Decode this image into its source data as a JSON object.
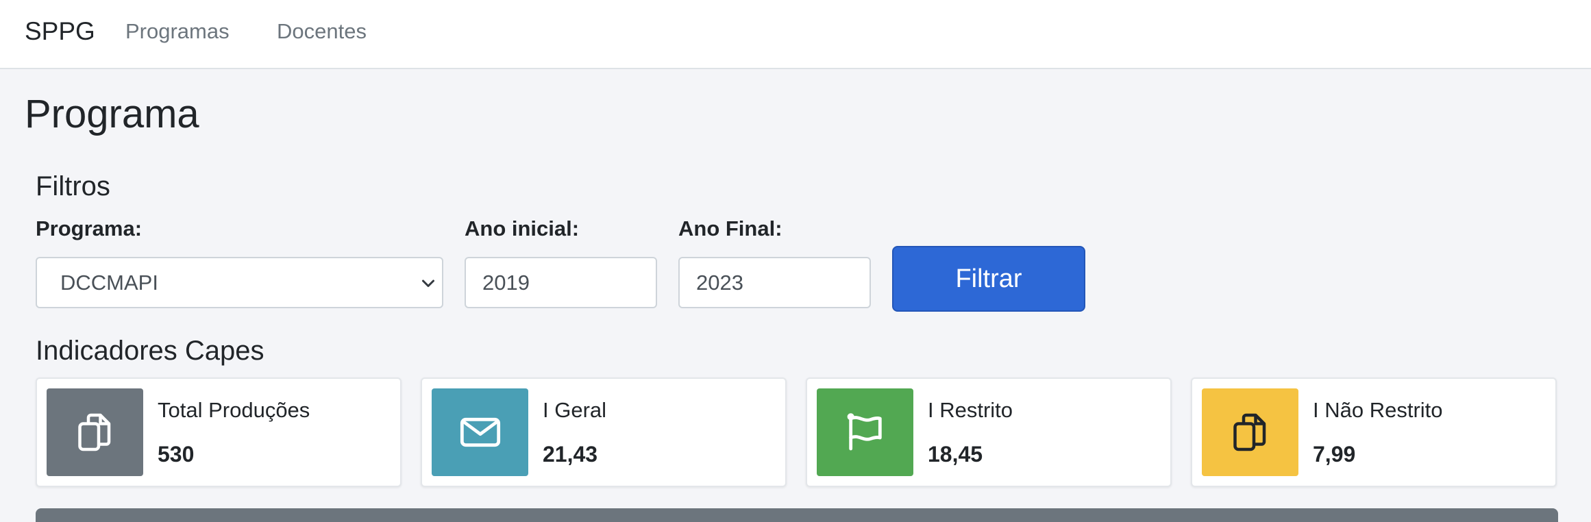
{
  "nav": {
    "brand": "SPPG",
    "links": [
      "Programas",
      "Docentes"
    ]
  },
  "page": {
    "title": "Programa"
  },
  "filters": {
    "title": "Filtros",
    "programa": {
      "label": "Programa:",
      "value": "DCCMAPI"
    },
    "ano_inicial": {
      "label": "Ano inicial:",
      "value": "2019"
    },
    "ano_final": {
      "label": "Ano Final:",
      "value": "2023"
    },
    "submit_label": "Filtrar"
  },
  "indicators": {
    "title": "Indicadores Capes",
    "cards": [
      {
        "label": "Total Produções",
        "value": "530",
        "icon": "copy-icon",
        "color": "#6c757d"
      },
      {
        "label": "I Geral",
        "value": "21,43",
        "icon": "envelope-icon",
        "color": "#4a9fb5"
      },
      {
        "label": "I Restrito",
        "value": "18,45",
        "icon": "flag-icon",
        "color": "#52a852"
      },
      {
        "label": "I Não Restrito",
        "value": "7,99",
        "icon": "copy-icon",
        "color": "#f5c342"
      }
    ]
  },
  "colors": {
    "primary": "#2d68d6",
    "page_bg": "#f4f5f8"
  }
}
